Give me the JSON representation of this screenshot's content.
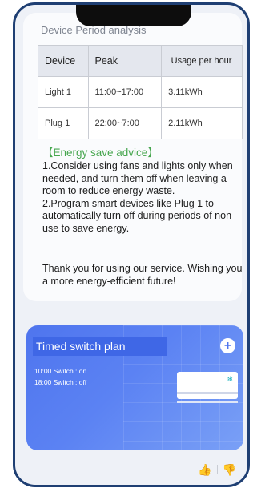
{
  "analysis": {
    "section_title": "Device Period analysis",
    "table": {
      "headers": [
        "Device",
        "Peak",
        "Usage per hour"
      ],
      "rows": [
        [
          "Light 1",
          "11:00~17:00",
          "3.11kWh"
        ],
        [
          "Plug 1",
          "22:00~7:00",
          "2.11kWh"
        ]
      ]
    }
  },
  "advice": {
    "title": "【Energy save advice】",
    "items": [
      "1.Consider using fans and lights only when needed, and turn them off when leaving a room to reduce energy waste.",
      "2.Program smart devices like Plug 1 to automatically turn off during periods of non-use to save energy."
    ],
    "thanks": "Thank you for using our service. Wishing you a more energy-efficient future!"
  },
  "plan": {
    "title": "Timed switch plan",
    "add_icon": "+",
    "items": [
      "10:00 Switch : on",
      "18:00 Switch : off"
    ],
    "ac_icon": "❄"
  },
  "feedback": {
    "thumbs_up_icon": "👍",
    "thumbs_down_icon": "👎"
  }
}
